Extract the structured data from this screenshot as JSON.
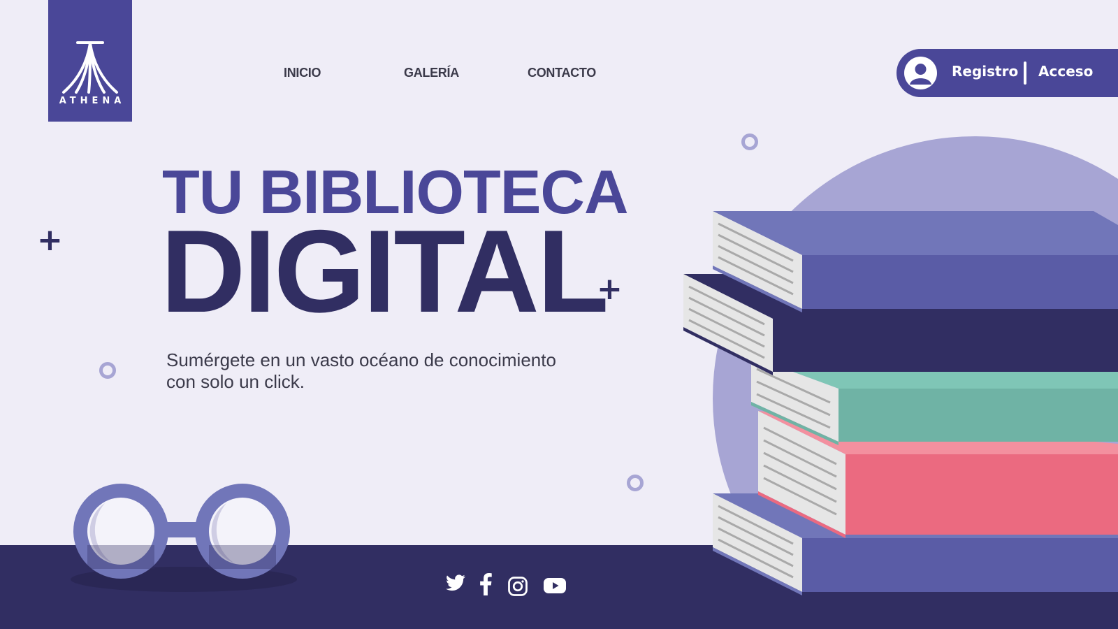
{
  "brand": {
    "name": "ATHENA"
  },
  "nav": {
    "items": [
      {
        "label": "INICIO"
      },
      {
        "label": "GALERÍA"
      },
      {
        "label": "CONTACTO"
      }
    ]
  },
  "auth": {
    "register_label": "Registro",
    "login_label": "Acceso",
    "user_icon": "user-circle-icon"
  },
  "hero": {
    "title_line1": "TU BIBLIOTECA",
    "title_line2": "DIGITAL",
    "subtitle_line1": "Sumérgete en un vasto océano de conocimiento",
    "subtitle_line2": "con solo un click."
  },
  "social": [
    {
      "icon": "twitter-icon"
    },
    {
      "icon": "facebook-icon"
    },
    {
      "icon": "instagram-icon"
    },
    {
      "icon": "youtube-icon"
    }
  ],
  "colors": {
    "background": "#efedf7",
    "primary": "#4a4798",
    "dark": "#312e62",
    "accent_light": "#a7a5d4",
    "book_teal": "#6fb3a5",
    "book_pink": "#eb6a80"
  }
}
